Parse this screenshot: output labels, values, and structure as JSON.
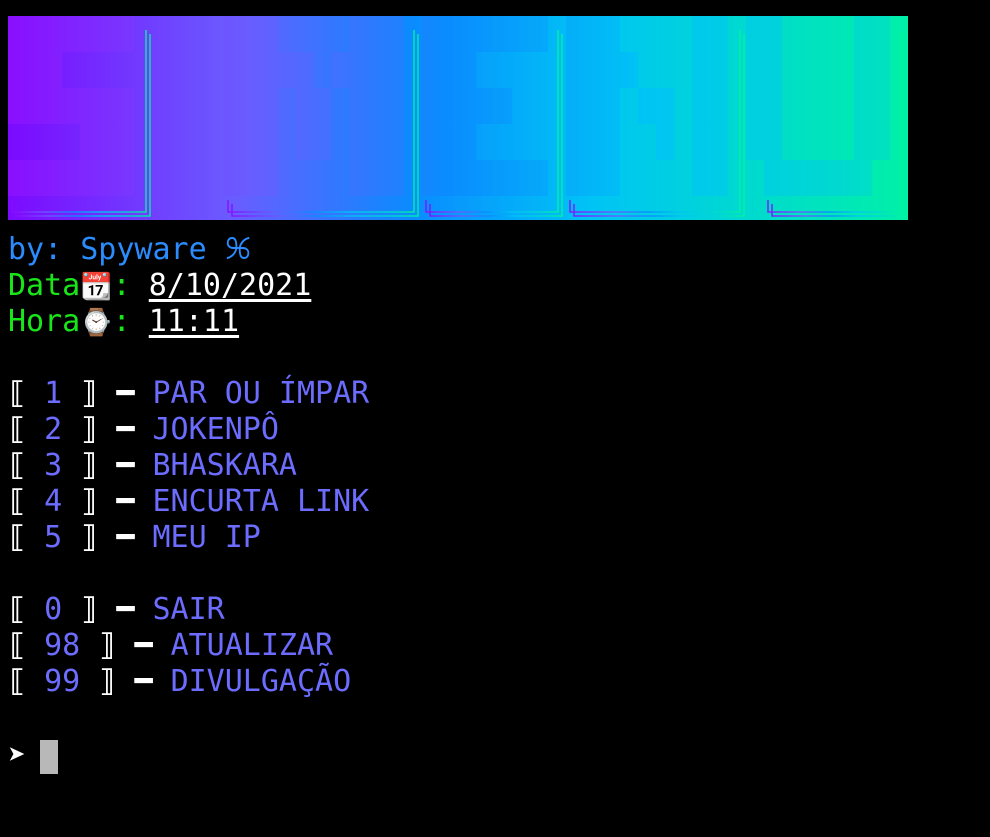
{
  "banner": {
    "text": "S MENU"
  },
  "author": {
    "label": "by:",
    "name": "Spyware",
    "glyph": "ꕑ"
  },
  "date": {
    "label": "Data",
    "icon": "calendar-icon",
    "sep": ":",
    "value": "8/10/2021"
  },
  "time": {
    "label": "Hora",
    "icon": "clock-icon",
    "sep": ":",
    "value": "11:11"
  },
  "menu": [
    {
      "num": "1",
      "label": "PAR OU ÍMPAR"
    },
    {
      "num": "2",
      "label": "JOKENPÔ"
    },
    {
      "num": "3",
      "label": "BHASKARA"
    },
    {
      "num": "4",
      "label": "ENCURTA LINK"
    },
    {
      "num": "5",
      "label": "MEU IP"
    }
  ],
  "extras": [
    {
      "num": "0",
      "label": "SAIR"
    },
    {
      "num": "98",
      "label": "ATUALIZAR"
    },
    {
      "num": "99",
      "label": "DIVULGAÇÃO"
    }
  ],
  "prompt": {
    "symbol": "➤"
  }
}
